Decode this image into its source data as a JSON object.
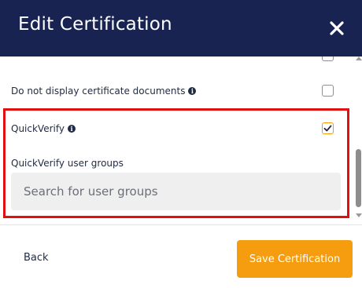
{
  "header": {
    "title": "Edit Certification",
    "close_icon": "close-icon",
    "background_color": "#192352"
  },
  "options": [
    {
      "label": "Do not display certificate documents",
      "has_info_icon": true,
      "checked": false
    },
    {
      "label": "QuickVerify",
      "has_info_icon": true,
      "checked": true
    }
  ],
  "user_groups": {
    "label": "QuickVerify user groups",
    "placeholder": "Search for user groups",
    "value": ""
  },
  "footer": {
    "back_label": "Back",
    "save_label": "Save Certification",
    "save_color": "#f59d0e"
  },
  "highlight_color": "#e01010"
}
